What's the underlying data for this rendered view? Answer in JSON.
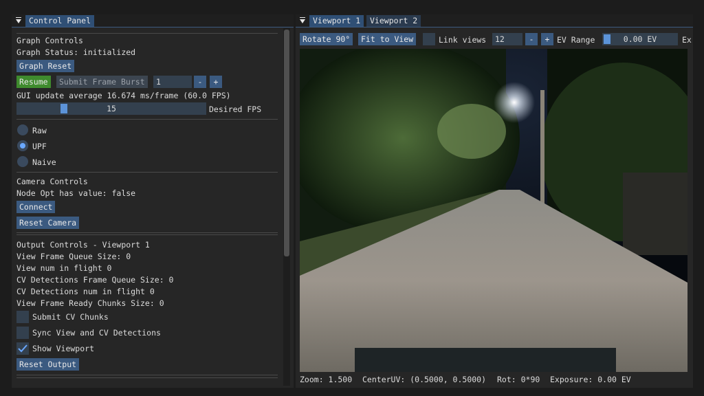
{
  "left_panel": {
    "tab_label": "Control Panel",
    "graph_section": {
      "heading": "Graph Controls",
      "status": "Graph Status: initialized",
      "reset_label": "Graph Reset",
      "resume_label": "Resume",
      "submit_burst_label": "Submit Frame Burst",
      "burst_value": "1",
      "minus_label": "-",
      "plus_label": "+",
      "gui_update": "GUI update average 16.674 ms/frame (60.0 FPS)",
      "fps_slider_value": "15",
      "fps_slider_fraction": 0.12,
      "fps_slider_label": "Desired FPS"
    },
    "modes": [
      {
        "label": "Raw",
        "selected": false
      },
      {
        "label": "UPF",
        "selected": true
      },
      {
        "label": "Naive",
        "selected": false
      }
    ],
    "camera_section": {
      "heading": "Camera Controls",
      "node_opt": "Node Opt has value: false",
      "connect_label": "Connect",
      "reset_label": "Reset Camera"
    },
    "output_section": {
      "heading": "Output Controls - Viewport 1",
      "lines": [
        "View Frame Queue Size: 0",
        "View num in flight 0",
        "CV Detections Frame Queue Size: 0",
        "CV Detections num in flight 0",
        "View Frame Ready Chunks Size: 0"
      ],
      "checkboxes": [
        {
          "label": "Submit CV Chunks",
          "checked": false
        },
        {
          "label": "Sync View and CV Detections",
          "checked": false
        },
        {
          "label": "Show Viewport",
          "checked": true
        }
      ],
      "reset_label": "Reset Output"
    }
  },
  "right_panel": {
    "tabs": [
      {
        "label": "Viewport 1",
        "active": true
      },
      {
        "label": "Viewport 2",
        "active": false
      }
    ],
    "toolbar": {
      "rotate_label": "Rotate 90°",
      "fit_label": "Fit to View",
      "link_label": "Link views",
      "link_value": "12",
      "minus_label": "-",
      "plus_label": "+",
      "ev_range_label": "EV Range",
      "ev_value": "0.00 EV",
      "overflow_label": "Ex"
    },
    "status_bar": {
      "zoom": "Zoom: 1.500",
      "center": "CenterUV: (0.5000, 0.5000)",
      "rot": "Rot: 0*90",
      "exposure": "Exposure: 0.00 EV"
    }
  },
  "colors": {
    "accent": "#3b5a80",
    "active_tab": "#2f4f75",
    "green": "#3f8b2e",
    "radio_dot": "#6aa8ff"
  }
}
